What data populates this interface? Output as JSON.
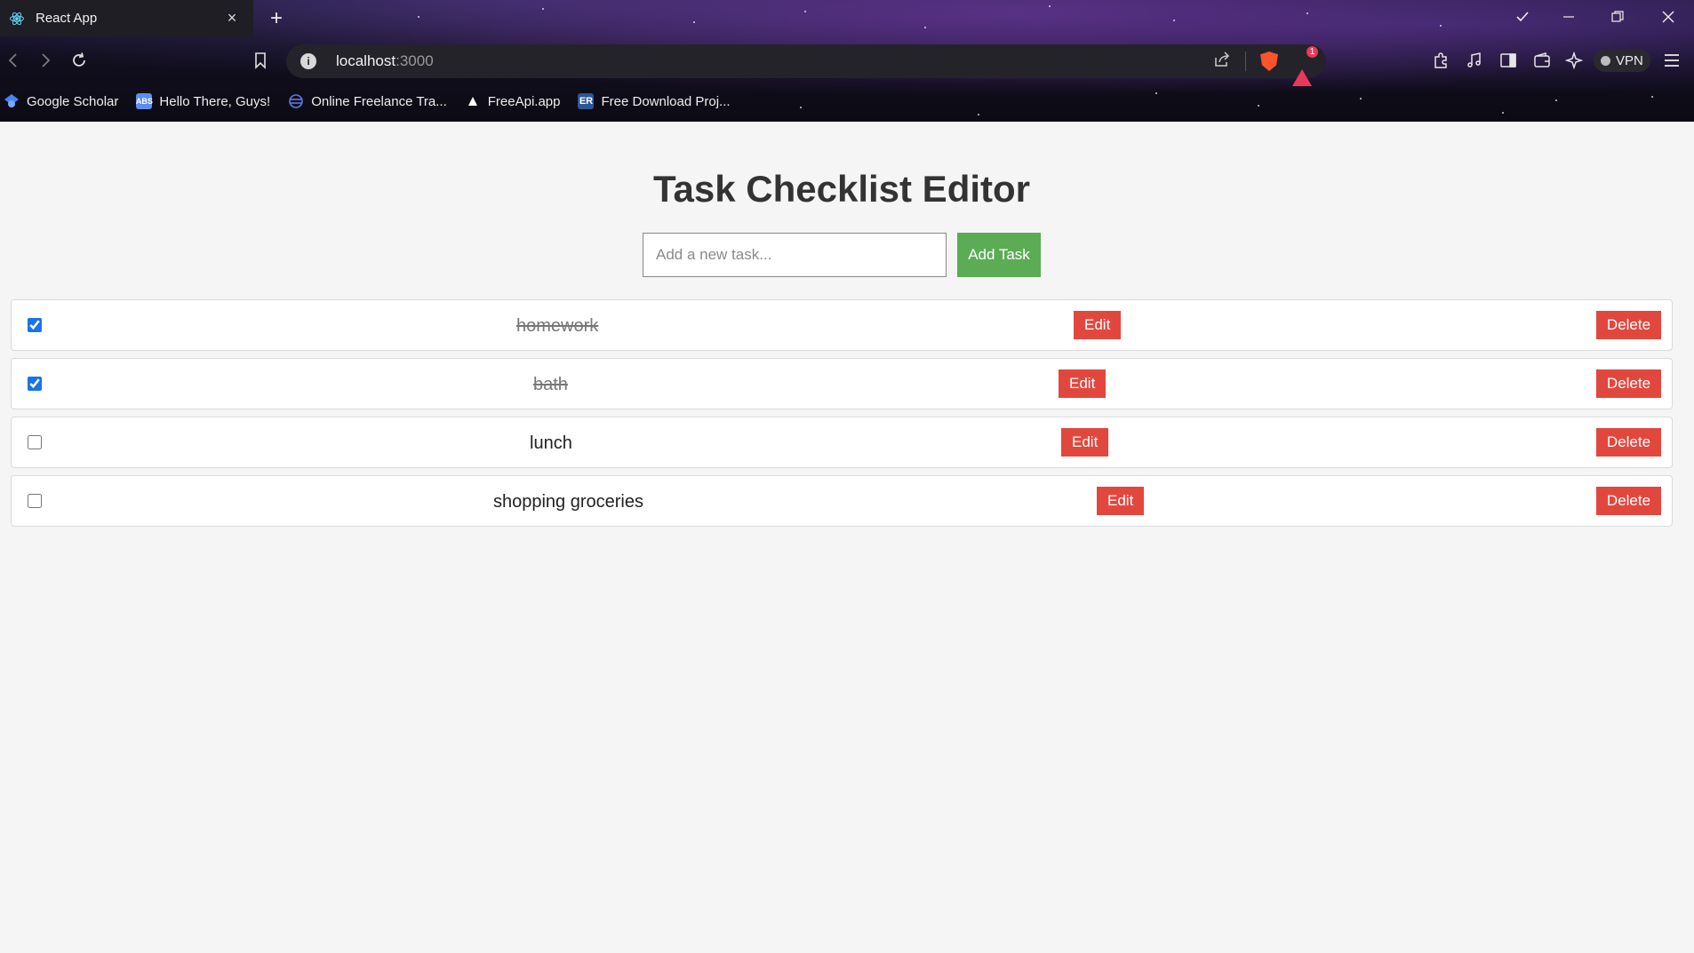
{
  "browser": {
    "tab_title": "React App",
    "tab_close": "×",
    "new_tab": "+",
    "url_host": "localhost",
    "url_port": ":3000",
    "rewards_badge": "1",
    "vpn_label": "VPN",
    "bookmarks": [
      {
        "label": "Google Scholar",
        "icon": "google-scholar-icon",
        "color": "#4285f4"
      },
      {
        "label": "Hello There, Guys!",
        "icon": "abs-icon",
        "color": "#5b8def"
      },
      {
        "label": "Online Freelance Tra...",
        "icon": "freelance-icon",
        "color": "#3d6bd8"
      },
      {
        "label": "FreeApi.app",
        "icon": "freeapi-icon",
        "color": "#ffffff"
      },
      {
        "label": "Free Download Proj...",
        "icon": "er-icon",
        "color": "#2b5797"
      }
    ]
  },
  "app": {
    "title": "Task Checklist Editor",
    "input_placeholder": "Add a new task...",
    "add_button": "Add Task",
    "edit_label": "Edit",
    "delete_label": "Delete",
    "accent_green": "#5cac55",
    "accent_red": "#e2473e",
    "tasks": [
      {
        "text": "homework",
        "completed": true
      },
      {
        "text": "bath",
        "completed": true
      },
      {
        "text": "lunch",
        "completed": false
      },
      {
        "text": "shopping groceries",
        "completed": false
      }
    ]
  }
}
